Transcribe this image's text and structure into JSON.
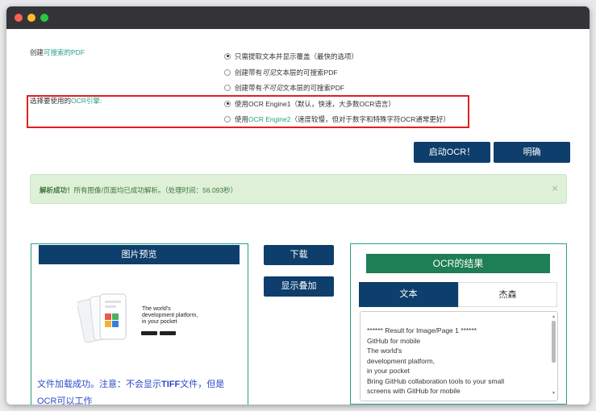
{
  "settings": {
    "pdf_label_prefix": "创建",
    "pdf_label_link": "可搜索的PDF",
    "pdf_options": [
      {
        "label": "只需提取文本并显示覆盖（最快的选项）",
        "selected": true
      },
      {
        "label_parts": [
          "创建带有",
          "可见",
          "文本层的可搜索PDF"
        ],
        "selected": false
      },
      {
        "label_parts": [
          "创建带有",
          "不可见",
          "文本层的可搜索PDF"
        ],
        "selected": false
      }
    ],
    "engine_label_prefix": "选择要使用的",
    "engine_label_link": "OCR引擎",
    "engine_label_suffix": ":",
    "engine_options": [
      {
        "prefix": "使用",
        "name": "OCR Engine1",
        "desc": "（默认，快速，大多数OCR语言）",
        "selected": true
      },
      {
        "prefix": "使用",
        "name": "OCR Engine2",
        "desc": "（速度较慢，但对于数字和特殊字符OCR通常更好）",
        "selected": false
      }
    ]
  },
  "actions": {
    "start_label": "启动OCR！",
    "clear_label": "明确"
  },
  "alert": {
    "strong": "解析成功！",
    "message": "所有图像/页面均已成功解析。（处理时间：56.093秒）",
    "close": "×"
  },
  "preview": {
    "title": "图片预览",
    "image_text": [
      "The world's",
      "development platform,",
      "in your pocket"
    ],
    "status_pre": "文件加载成功。注意：不会显示",
    "status_strong": "TIFF",
    "status_post": "文件，但是",
    "status_line2": "OCR可以工作"
  },
  "middle": {
    "download_label": "下载",
    "overlay_label": "显示叠加"
  },
  "result": {
    "title": "OCR的结果",
    "tabs": [
      {
        "label": "文本",
        "active": true
      },
      {
        "label": "杰森",
        "active": false
      }
    ],
    "lines": [
      "****** Result for Image/Page 1 ******",
      "GitHub for mobile",
      "The world's",
      "development platform,",
      "in your pocket",
      "Bring GitHub collaboration tools to your small",
      "screens with GitHub for mobile"
    ]
  },
  "colors": {
    "accent_teal": "#27a085",
    "button_navy": "#0e3e6b",
    "ocr_header_green": "#1e7e54",
    "highlight_red": "#e02020",
    "alert_bg": "#dff0d8"
  }
}
